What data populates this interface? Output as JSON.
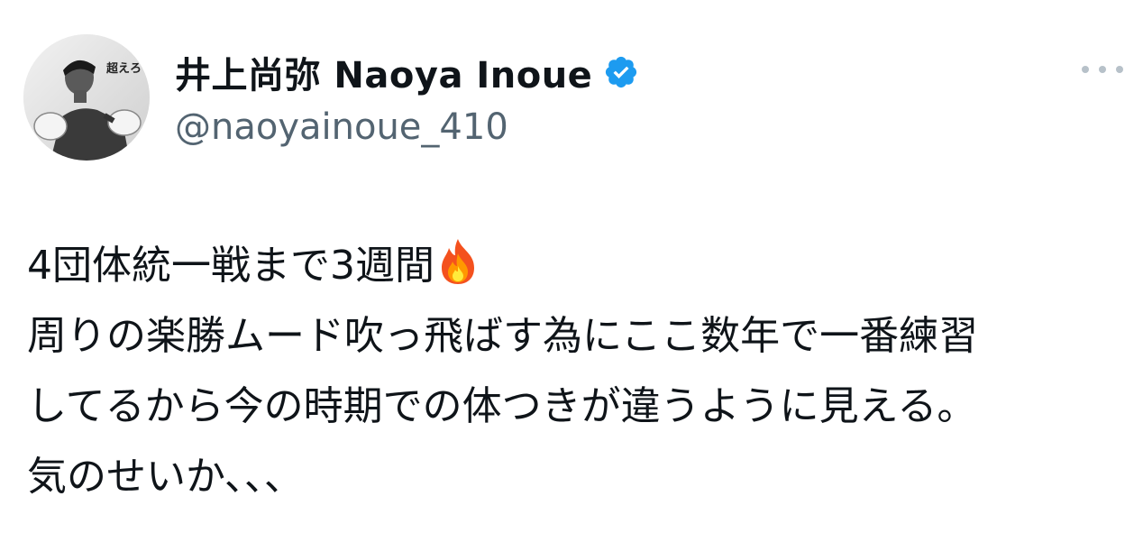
{
  "author": {
    "display_name": "井上尚弥  Naoya Inoue",
    "handle": "@naoyainoue_410",
    "avatar_text": "超えろ",
    "avatar_icon": "boxer-avatar",
    "verified_icon": "verified-badge-icon"
  },
  "menu": {
    "icon": "more-options-icon"
  },
  "tweet": {
    "lines": [
      "4団体統一戦まで3週間",
      "周りの楽勝ムード吹っ飛ばす為にここ数年で一番練習",
      "してるから今の時期での体つきが違うように見える。",
      "気のせいか､､､"
    ],
    "emoji_icon": "fire-emoji-icon"
  },
  "colors": {
    "text": "#0f1419",
    "secondary": "#536471",
    "verified": "#1d9bf0",
    "menu_dots": "#b7c1c9"
  }
}
